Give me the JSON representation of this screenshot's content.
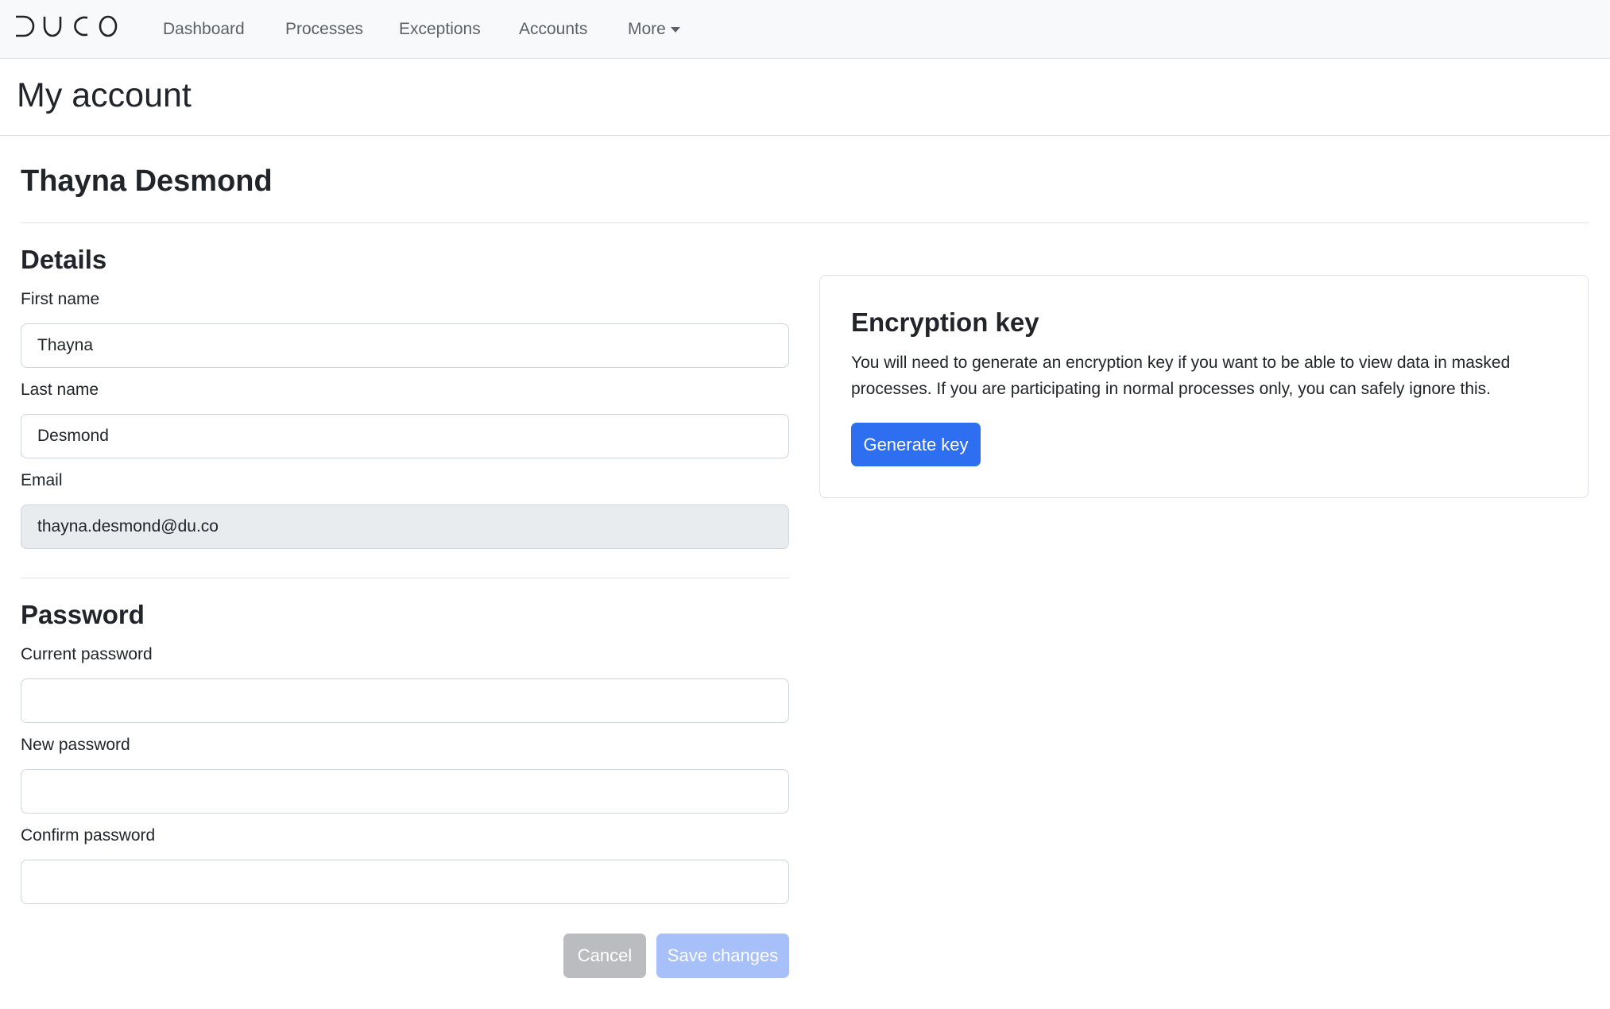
{
  "navbar": {
    "logo_text": "DUCO",
    "items": [
      {
        "label": "Dashboard"
      },
      {
        "label": "Processes"
      },
      {
        "label": "Exceptions"
      },
      {
        "label": "Accounts"
      },
      {
        "label": "More"
      }
    ]
  },
  "page": {
    "title": "My account",
    "user_name": "Thayna Desmond"
  },
  "details": {
    "title": "Details",
    "first_name": {
      "label": "First name",
      "value": "Thayna"
    },
    "last_name": {
      "label": "Last name",
      "value": "Desmond"
    },
    "email": {
      "label": "Email",
      "value": "thayna.desmond@du.co"
    }
  },
  "password": {
    "title": "Password",
    "current": {
      "label": "Current password",
      "value": ""
    },
    "new": {
      "label": "New password",
      "value": ""
    },
    "confirm": {
      "label": "Confirm password",
      "value": ""
    }
  },
  "actions": {
    "cancel_label": "Cancel",
    "save_label": "Save changes"
  },
  "encryption": {
    "title": "Encryption key",
    "description": "You will need to generate an encryption key if you want to be able to view data in masked processes. If you are participating in normal processes only, you can safely ignore this.",
    "button_label": "Generate key"
  },
  "colors": {
    "primary": "#2e6ef0",
    "primary_disabled": "#a8c0f9",
    "secondary_disabled": "#babcbf",
    "navbar_bg": "#f8f9fa",
    "input_disabled_bg": "#e9ecef"
  },
  "icons": {
    "more_caret": "caret-down-icon",
    "logo": "duco-logo"
  }
}
